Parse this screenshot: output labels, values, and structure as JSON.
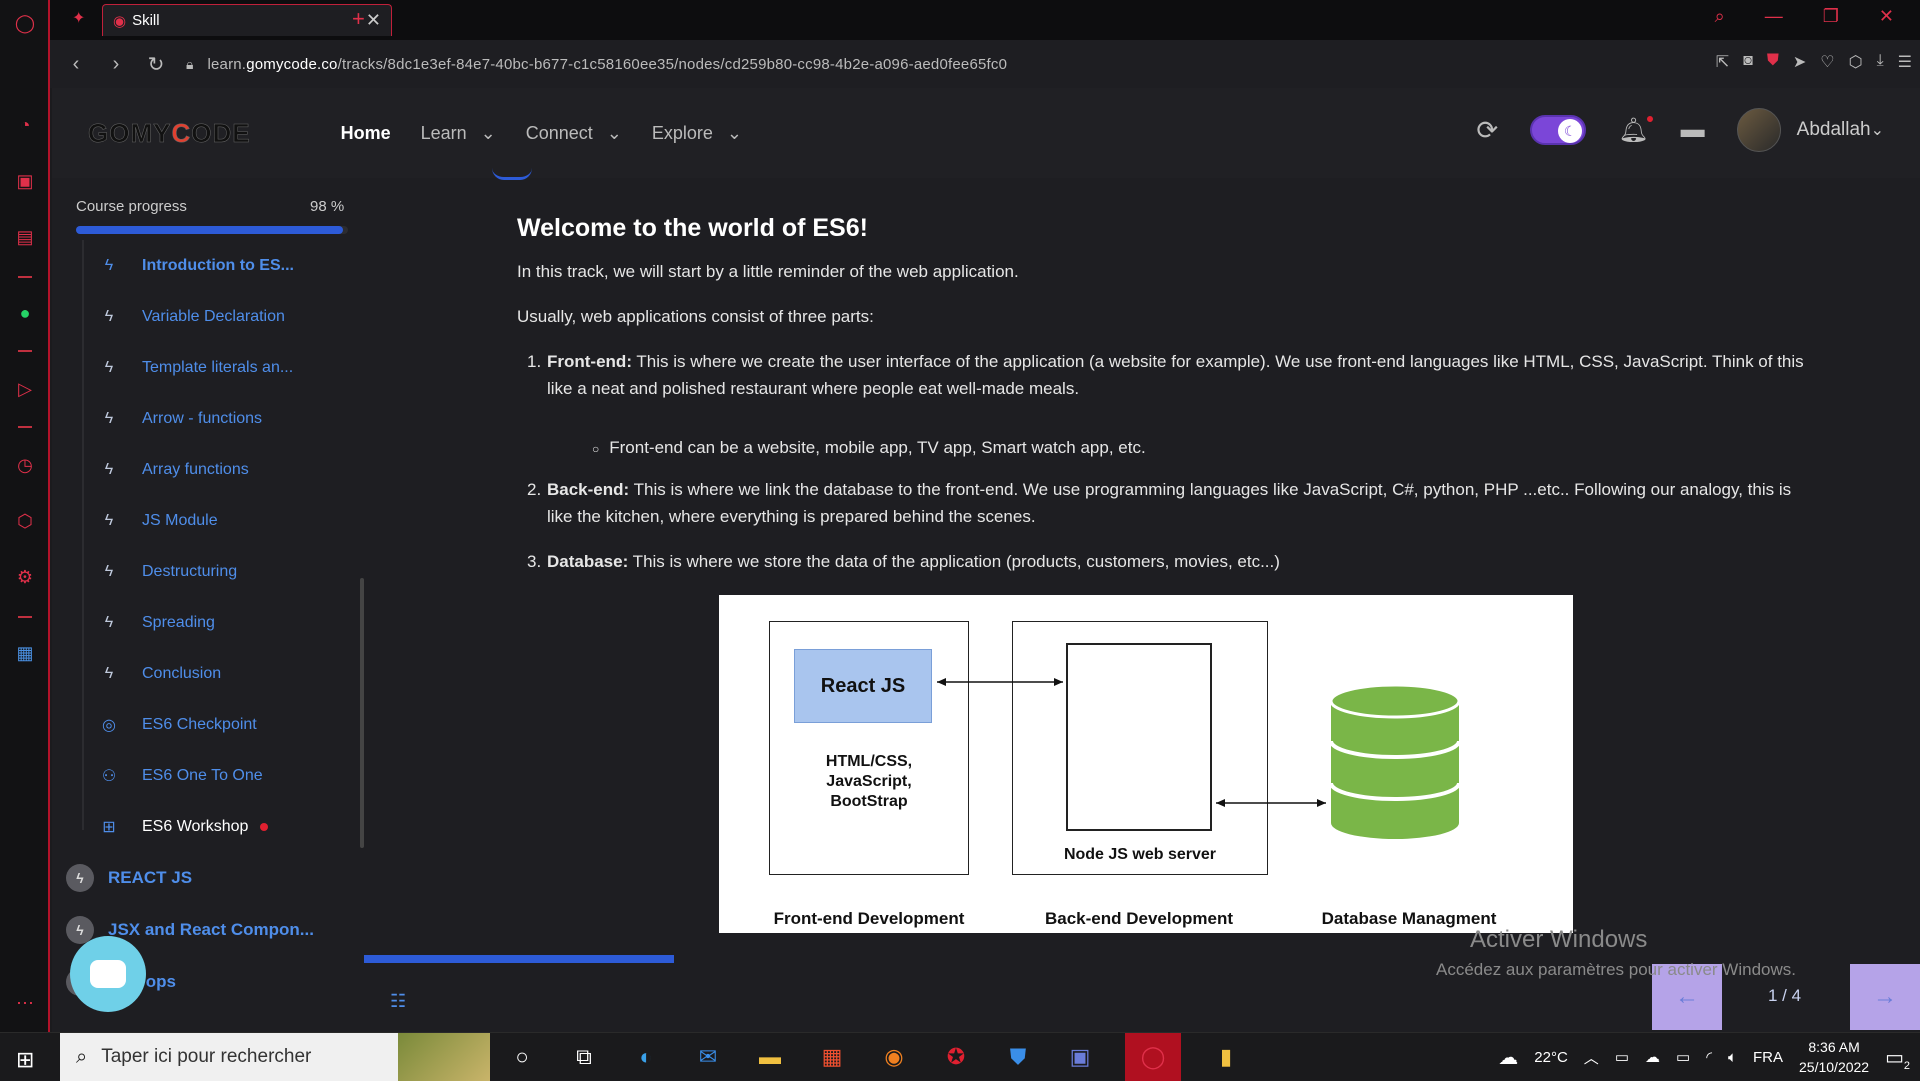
{
  "browser": {
    "tab_title": "Skill",
    "url_domain": "gomycode.co",
    "url_prefix": "learn.",
    "url_path": "/tracks/8dc1e3ef-84e7-40bc-b677-c1c58160ee35/nodes/cd259b80-cc98-4b2e-a096-aed0fee65fc0"
  },
  "nav": {
    "logo": "GOMYCODE",
    "home": "Home",
    "learn": "Learn",
    "connect": "Connect",
    "explore": "Explore",
    "username": "Abdallah"
  },
  "sidebar": {
    "progress_label": "Course progress",
    "progress_value": "98 %",
    "progress_fraction": 0.98,
    "lessons": [
      {
        "label": "Introduction to ES...",
        "state": "current"
      },
      {
        "label": "Variable Declaration"
      },
      {
        "label": "Template literals an..."
      },
      {
        "label": "Arrow - functions"
      },
      {
        "label": "Array functions"
      },
      {
        "label": "JS Module"
      },
      {
        "label": "Destructuring"
      },
      {
        "label": "Spreading"
      },
      {
        "label": "Conclusion"
      },
      {
        "label": "ES6 Checkpoint"
      },
      {
        "label": "ES6 One To One"
      },
      {
        "label": "ES6 Workshop"
      }
    ],
    "sections": [
      "REACT JS",
      "JSX and React Compon...",
      "ct Props"
    ]
  },
  "content": {
    "title": "Welcome to the world of ES6!",
    "p1": "In this track, we will start by a little reminder of the web application.",
    "p2": "Usually, web applications consist of three parts:",
    "items": [
      {
        "num": "1.",
        "bold": "Front-end:",
        "text": " This is where we create the user interface of the application (a website for example). We use front-end languages like HTML, CSS, JavaScript. Think of this like a neat and polished restaurant where people eat well-made meals."
      },
      {
        "num": "2.",
        "bold": "Back-end:",
        "text": " This is where we link the database to the front-end. We use programming languages like JavaScript, C#, python, PHP ...etc.. Following our analogy, this is like the kitchen, where everything is prepared behind the scenes."
      },
      {
        "num": "3.",
        "bold": "Database:",
        "text": " This is where we store the data of the application (products, customers, movies, etc...)"
      }
    ],
    "bullet": "Front-end can be a website, mobile app, TV app, Smart watch app, etc.",
    "diagram": {
      "react": "React JS",
      "frontend_tech_1": "HTML/CSS,",
      "frontend_tech_2": "JavaScript,",
      "frontend_tech_3": "BootStrap",
      "server": "Node JS web server",
      "label_front": "Front-end Development",
      "label_back": "Back-end Development",
      "label_db": "Database Managment"
    }
  },
  "pager": {
    "text": "1 / 4"
  },
  "watermark": {
    "line1": "Activer Windows",
    "line2": "Accédez aux paramètres pour activer Windows."
  },
  "taskbar": {
    "search": "Taper ici pour rechercher",
    "temp": "22°C",
    "lang": "FRA",
    "time": "8:36 AM",
    "date": "25/10/2022",
    "notif": "2"
  }
}
